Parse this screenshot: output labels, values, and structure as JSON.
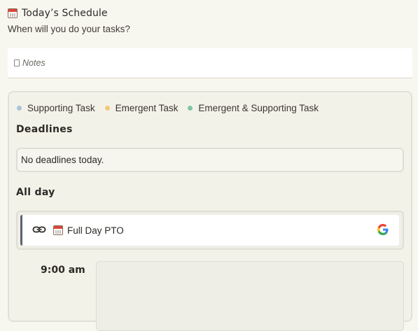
{
  "header": {
    "title": "Today’s Schedule",
    "subtitle": "When will you do your tasks?",
    "icon": "calendar-icon"
  },
  "notes": {
    "label": "Notes",
    "icon": "page-icon"
  },
  "legend": [
    {
      "label": "Supporting Task",
      "color": "#a9c4dc"
    },
    {
      "label": "Emergent Task",
      "color": "#f2c879"
    },
    {
      "label": "Emergent & Supporting Task",
      "color": "#7fc6a4"
    }
  ],
  "deadlines": {
    "title": "Deadlines",
    "empty_text": "No deadlines today."
  },
  "all_day": {
    "title": "All day",
    "events": [
      {
        "label": "Full Day PTO",
        "icon": "calendar-icon",
        "link_icon": "link-icon",
        "source_icon": "google-icon"
      }
    ]
  },
  "timeline": {
    "first_time": "9:00 am"
  },
  "colors": {
    "background": "#f8f7ef",
    "panel": "#f3f2e9",
    "event_accent": "#5a6470"
  }
}
